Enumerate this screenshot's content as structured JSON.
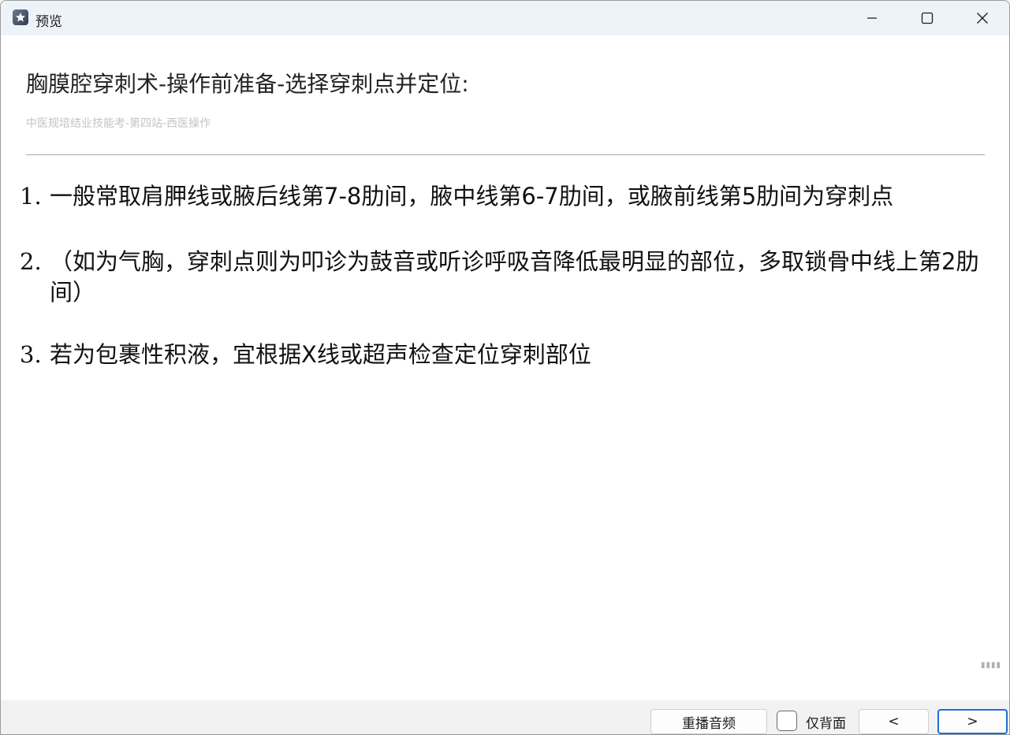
{
  "window": {
    "title": "预览",
    "icon": "app-icon"
  },
  "page": {
    "title": "胸膜腔穿刺术-操作前准备-选择穿刺点并定位:",
    "subtitle": "中医规培结业技能考-第四站-西医操作"
  },
  "items": [
    {
      "num": "1.",
      "text": "一般常取肩胛线或腋后线第7-8肋间，腋中线第6-7肋间，或腋前线第5肋间为穿刺点"
    },
    {
      "num": "2.",
      "text": "（如为气胸，穿刺点则为叩诊为鼓音或听诊呼吸音降低最明显的部位，多取锁骨中线上第2肋间）"
    },
    {
      "num": "3.",
      "text": "若为包裹性积液，宜根据X线或超声检查定位穿刺部位"
    }
  ],
  "footer": {
    "replay_label": "重播音频",
    "back_only_label": "仅背面",
    "back_only_checked": false,
    "prev_label": "<",
    "next_label": ">"
  },
  "colors": {
    "titlebar": "#eef3fa",
    "accent": "#1f6fd1"
  }
}
